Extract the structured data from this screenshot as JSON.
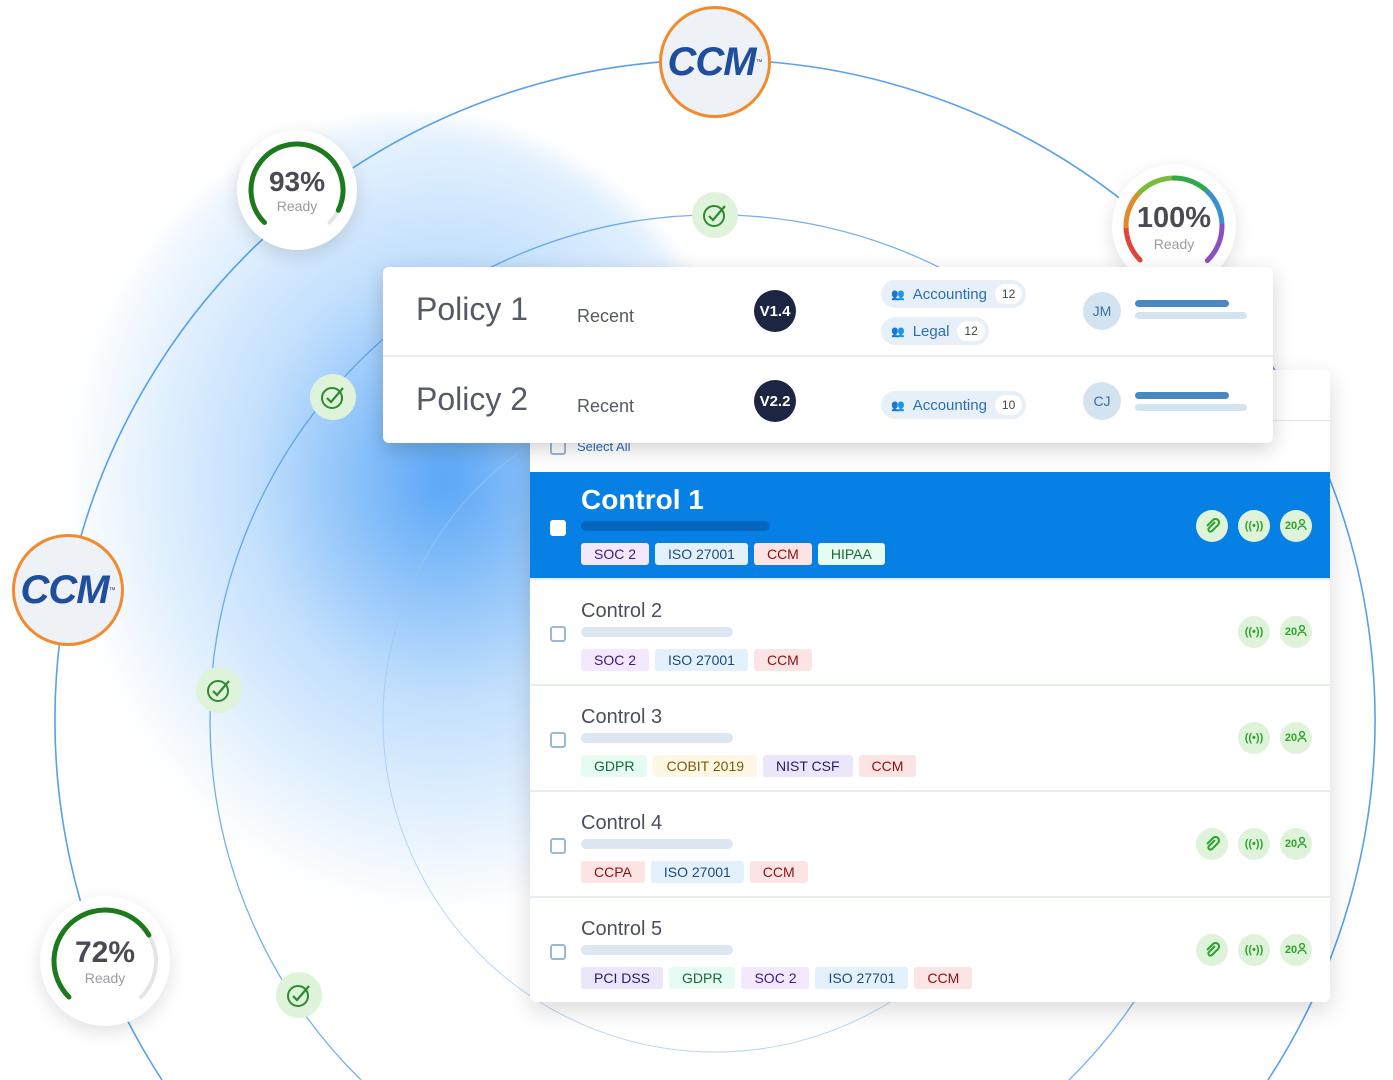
{
  "logos": {
    "text": "CCM",
    "tm": "™"
  },
  "gauges": [
    {
      "value": "93%",
      "label": "Ready",
      "percent": 93,
      "color": "#1c7a1c"
    },
    {
      "value": "100%",
      "label": "Ready",
      "percent": 100
    },
    {
      "value": "72%",
      "label": "Ready",
      "percent": 72,
      "color": "#1c7a1c"
    }
  ],
  "policies": [
    {
      "name": "Policy 1",
      "status": "Recent",
      "version": "V1.4",
      "departments": [
        {
          "name": "Accounting",
          "count": "12"
        },
        {
          "name": "Legal",
          "count": "12"
        }
      ],
      "owner": "JM"
    },
    {
      "name": "Policy 2",
      "status": "Recent",
      "version": "V2.2",
      "departments": [
        {
          "name": "Accounting",
          "count": "10"
        }
      ],
      "owner": "CJ"
    }
  ],
  "controls": {
    "select_all": "Select All",
    "accent": "#0780e6",
    "rows": [
      {
        "title": "Control 1",
        "active": true,
        "attachment": true,
        "count": "20",
        "tags": [
          "SOC 2",
          "ISO 27001",
          "CCM",
          "HIPAA"
        ]
      },
      {
        "title": "Control 2",
        "attachment": false,
        "count": "20",
        "tags": [
          "SOC 2",
          "ISO 27001",
          "CCM"
        ]
      },
      {
        "title": "Control 3",
        "attachment": false,
        "count": "20",
        "tags": [
          "GDPR",
          "COBIT 2019",
          "NIST CSF",
          "CCM"
        ]
      },
      {
        "title": "Control 4",
        "attachment": true,
        "count": "20",
        "tags": [
          "CCPA",
          "ISO 27001",
          "CCM"
        ]
      },
      {
        "title": "Control 5",
        "attachment": true,
        "count": "20",
        "tags": [
          "PCI DSS",
          "GDPR",
          "SOC 2",
          "ISO 27701",
          "CCM"
        ]
      }
    ]
  },
  "tag_colors": {
    "SOC 2": [
      "#f3e8fd",
      "#3b1a7a"
    ],
    "ISO 27001": [
      "#e3f1fd",
      "#1d4a7a"
    ],
    "ISO 27701": [
      "#e3f1fd",
      "#1d4a7a"
    ],
    "CCM": [
      "#fde4e4",
      "#8a1010"
    ],
    "HIPAA": [
      "#e6fbf1",
      "#17693a"
    ],
    "GDPR": [
      "#e6fbf1",
      "#17693a"
    ],
    "COBIT 2019": [
      "#fdf8e3",
      "#7a5a10"
    ],
    "NIST CSF": [
      "#ece6fb",
      "#2a1a6a"
    ],
    "CCPA": [
      "#fde4e4",
      "#8a1010"
    ],
    "PCI DSS": [
      "#ece6fb",
      "#2a1a6a"
    ]
  }
}
